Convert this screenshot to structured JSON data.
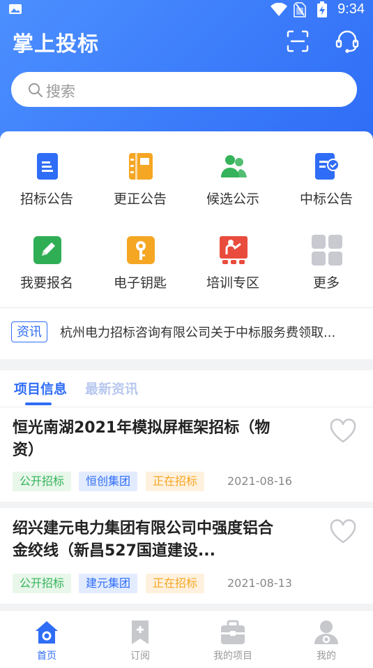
{
  "status_bar": {
    "time": "9:34"
  },
  "header": {
    "title": "掌上投标",
    "search_placeholder": "搜索"
  },
  "quick_menu": [
    {
      "label": "招标公告",
      "icon": "document-icon"
    },
    {
      "label": "更正公告",
      "icon": "notebook-icon"
    },
    {
      "label": "候选公示",
      "icon": "people-icon"
    },
    {
      "label": "中标公告",
      "icon": "checked-doc-icon"
    },
    {
      "label": "我要报名",
      "icon": "pencil-icon"
    },
    {
      "label": "电子钥匙",
      "icon": "key-icon"
    },
    {
      "label": "培训专区",
      "icon": "training-icon"
    },
    {
      "label": "更多",
      "icon": "grid-more-icon"
    }
  ],
  "news": {
    "tag": "资讯",
    "text": "杭州电力招标咨询有限公司关于中标服务费领取..."
  },
  "tabs": {
    "active": "项目信息",
    "inactive": "最新资讯"
  },
  "projects": [
    {
      "title": "恒光南湖2021年模拟屏框架招标（物资）",
      "tags": [
        "公开招标",
        "恒创集团",
        "正在招标"
      ],
      "date": "2021-08-16"
    },
    {
      "title": "绍兴建元电力集团有限公司中强度铝合金绞线（新昌527国道建设...",
      "tags": [
        "公开招标",
        "建元集团",
        "正在招标"
      ],
      "date": "2021-08-13"
    }
  ],
  "bottom_nav": [
    {
      "label": "首页",
      "icon": "home-icon",
      "active": true
    },
    {
      "label": "订阅",
      "icon": "bookmark-icon",
      "active": false
    },
    {
      "label": "我的项目",
      "icon": "briefcase-icon",
      "active": false
    },
    {
      "label": "我的",
      "icon": "user-icon",
      "active": false
    }
  ],
  "colors": {
    "primary": "#2f6df6",
    "green": "#35b35a",
    "orange": "#f5a623"
  }
}
